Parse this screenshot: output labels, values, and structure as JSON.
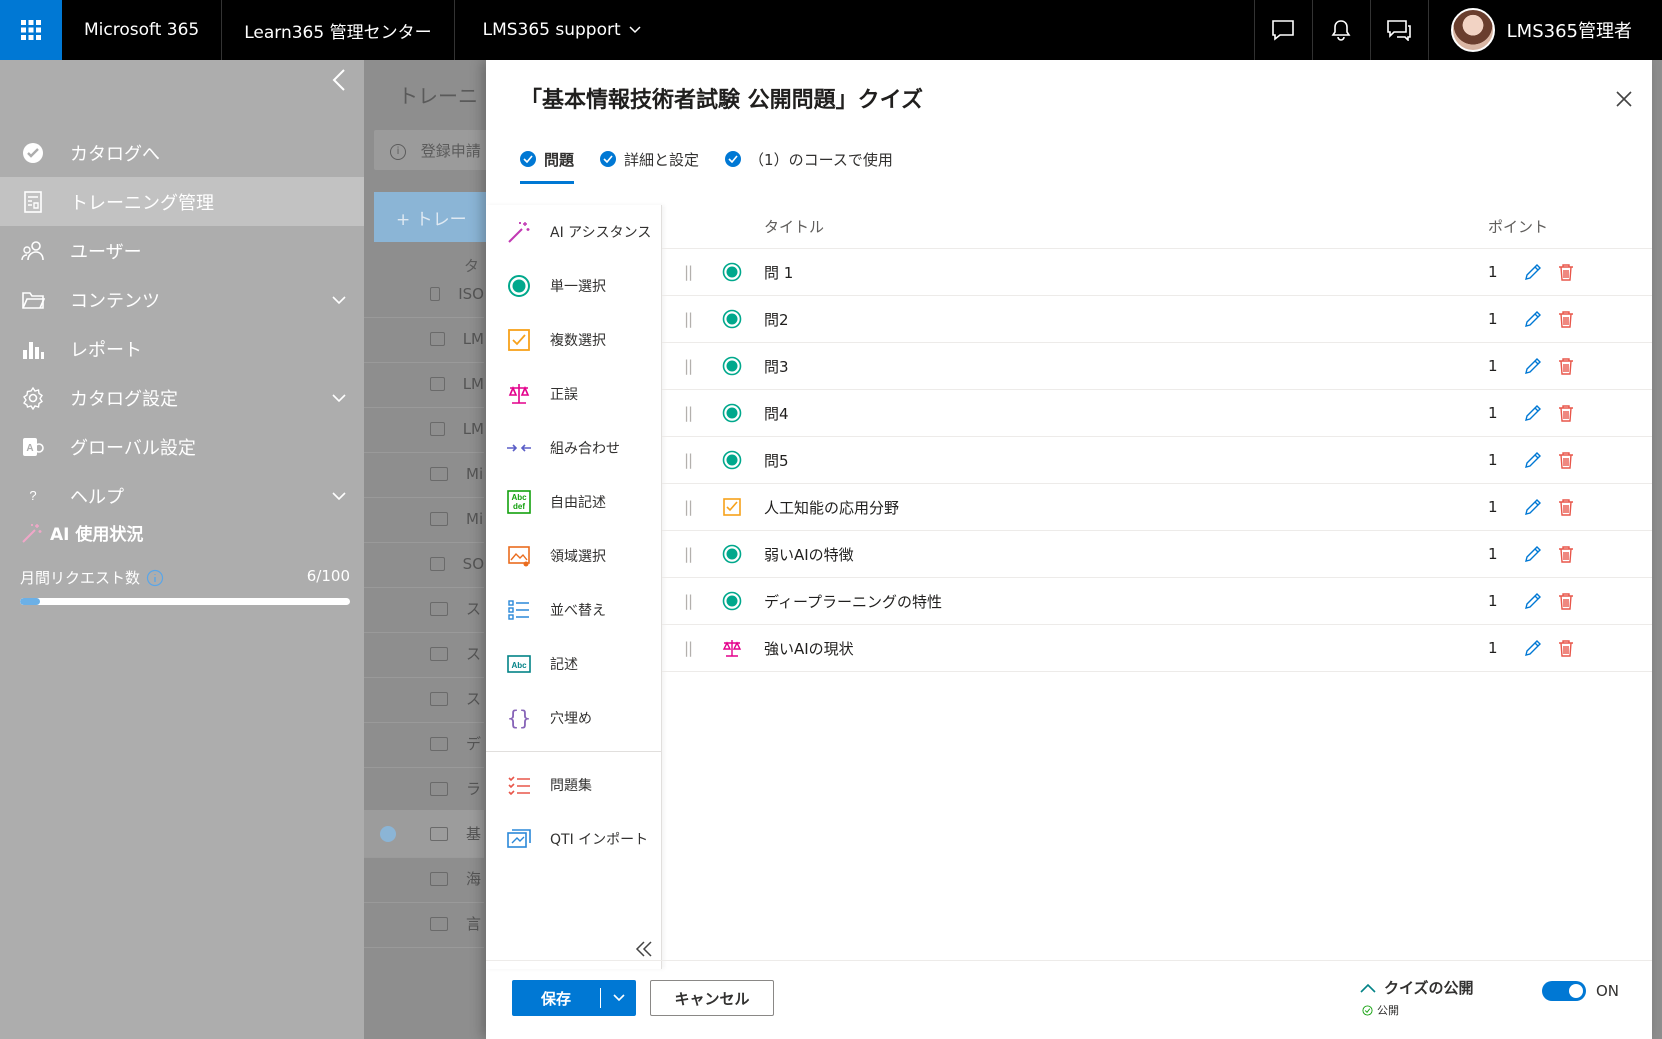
{
  "topbar": {
    "brand": "Microsoft 365",
    "app_title": "Learn365 管理センター",
    "workspace": "LMS365 support",
    "user_name": "LMS365管理者"
  },
  "sidebar": {
    "items": [
      {
        "label": "カタログへ",
        "icon": "catalog-icon"
      },
      {
        "label": "トレーニング管理",
        "icon": "training-icon",
        "active": true
      },
      {
        "label": "ユーザー",
        "icon": "users-icon"
      },
      {
        "label": "コンテンツ",
        "icon": "folder-icon",
        "expandable": true
      },
      {
        "label": "レポート",
        "icon": "chart-icon"
      },
      {
        "label": "カタログ設定",
        "icon": "gear-icon",
        "expandable": true
      },
      {
        "label": "グローバル設定",
        "icon": "global-settings-icon"
      },
      {
        "label": "ヘルプ",
        "icon": "help-icon",
        "expandable": true
      }
    ],
    "ai_usage": {
      "title": "AI 使用状況",
      "request_label": "月間リクエスト数",
      "request_value": "6/100",
      "request_fraction": 0.06
    }
  },
  "background": {
    "title": "トレーニ",
    "search_placeholder": "登録申請",
    "new_button": "+ トレー",
    "column": "タ",
    "rows": [
      "ISO",
      "LM",
      "LM",
      "LM",
      "Mi",
      "Mi",
      "SO",
      "ス",
      "ス",
      "ス",
      "デ",
      "ラ",
      "基",
      "海",
      "言"
    ]
  },
  "panel": {
    "title": "「基本情報技術者試験 公開問題」クイズ",
    "tabs": [
      "問題",
      "詳細と設定",
      "（1）のコースで使用"
    ],
    "question_types": [
      {
        "label": "AI アシスタンス",
        "icon": "magic-wand-icon",
        "color": "#c239b3"
      },
      {
        "label": "単一選択",
        "icon": "radio-icon",
        "color": "#00a88c"
      },
      {
        "label": "複数選択",
        "icon": "checkbox-icon",
        "color": "#f7a21b"
      },
      {
        "label": "正誤",
        "icon": "scales-icon",
        "color": "#e3008c"
      },
      {
        "label": "組み合わせ",
        "icon": "arrows-icon",
        "color": "#5b5fc7"
      },
      {
        "label": "自由記述",
        "icon": "abc-def-icon",
        "color": "#13a10e"
      },
      {
        "label": "領域選択",
        "icon": "image-area-icon",
        "color": "#ea6c1e"
      },
      {
        "label": "並べ替え",
        "icon": "list-order-icon",
        "color": "#2b88d8"
      },
      {
        "label": "記述",
        "icon": "abc-icon",
        "color": "#038387"
      },
      {
        "label": "穴埋め",
        "icon": "braces-icon",
        "color": "#8764b8"
      }
    ],
    "extra_types": [
      {
        "label": "問題集",
        "icon": "question-bank-icon",
        "color": "#e8564a"
      },
      {
        "label": "QTI インポート",
        "icon": "import-icon",
        "color": "#2b88d8"
      }
    ],
    "columns": {
      "title": "タイトル",
      "points": "ポイント"
    },
    "questions": [
      {
        "title": "問 1",
        "points": "1",
        "type": "single"
      },
      {
        "title": "問2",
        "points": "1",
        "type": "single"
      },
      {
        "title": "問3",
        "points": "1",
        "type": "single"
      },
      {
        "title": "問4",
        "points": "1",
        "type": "single"
      },
      {
        "title": "問5",
        "points": "1",
        "type": "single"
      },
      {
        "title": "人工知能の応用分野",
        "points": "1",
        "type": "multi"
      },
      {
        "title": "弱いAIの特徴",
        "points": "1",
        "type": "single"
      },
      {
        "title": "ディープラーニングの特性",
        "points": "1",
        "type": "single"
      },
      {
        "title": "強いAIの現状",
        "points": "1",
        "type": "truefalse"
      }
    ],
    "footer": {
      "save": "保存",
      "cancel": "キャンセル",
      "publish_label": "クイズの公開",
      "publish_status": "公開",
      "toggle_state": "ON"
    }
  },
  "colors": {
    "accent": "#0078d4",
    "single": "#00a88c",
    "multi": "#f7a21b",
    "truefalse": "#e3008c",
    "delete": "#e8564a"
  }
}
